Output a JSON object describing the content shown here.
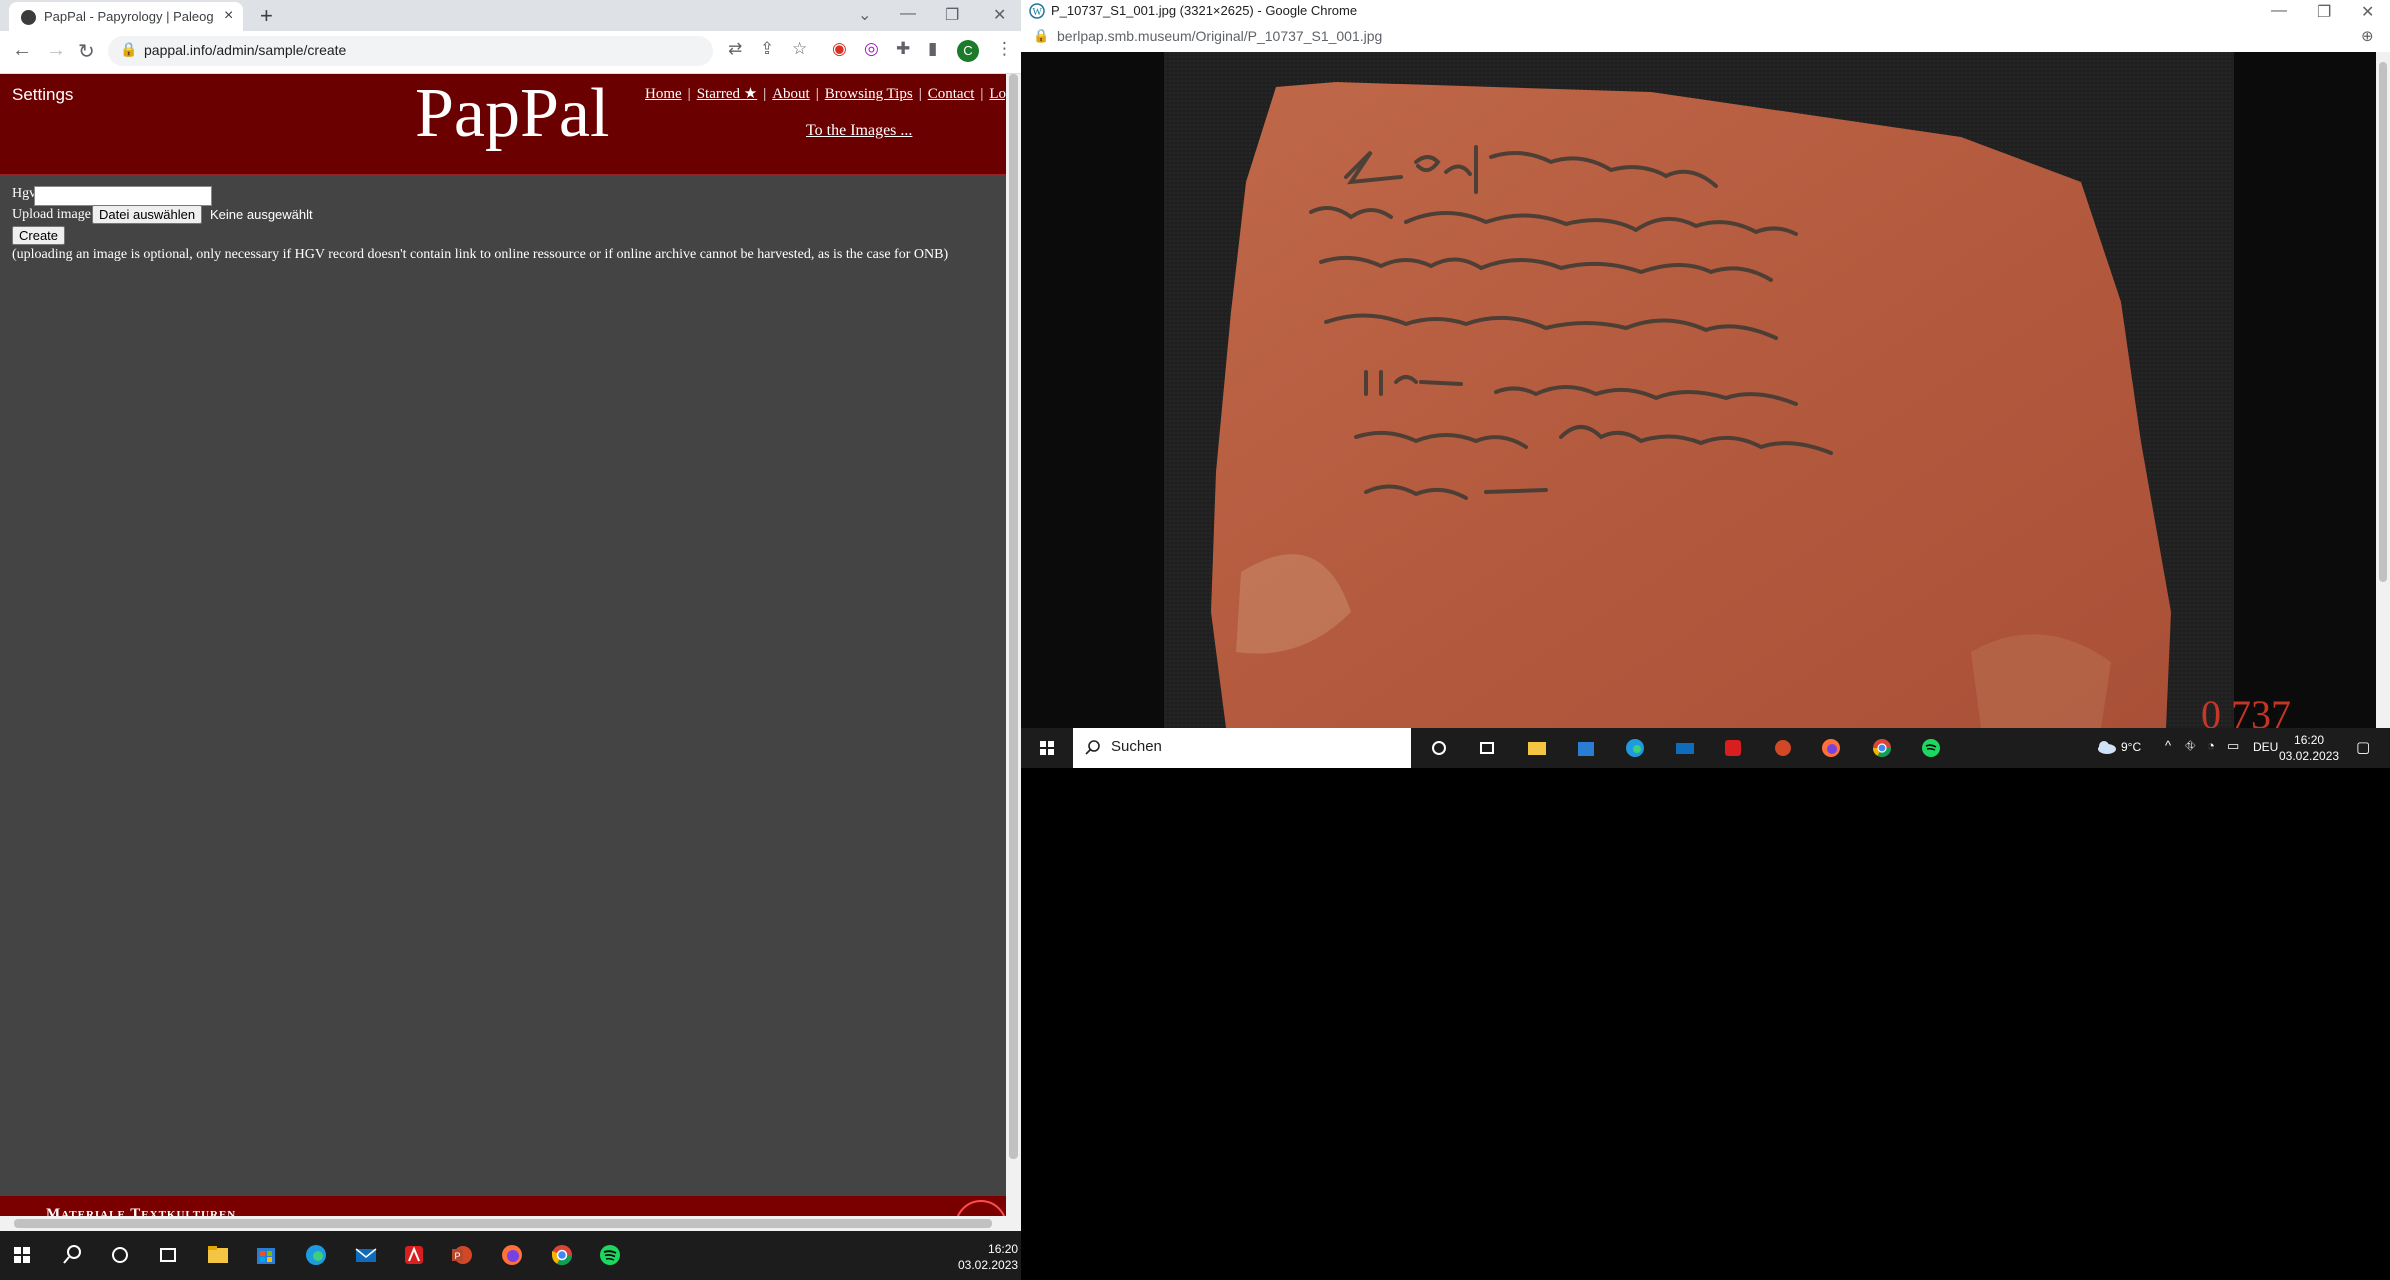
{
  "left_browser": {
    "tab_title": "PapPal - Papyrology | Paleograph",
    "new_tab_symbol": "+",
    "url": "pappal.info/admin/sample/create",
    "profile_initial": "C"
  },
  "site": {
    "settings_label": "Settings",
    "logo": "PapPal",
    "nav": [
      "Home",
      "Starred ★",
      "About",
      "Browsing Tips",
      "Contact",
      "Logout"
    ],
    "nav_separator": "|",
    "to_images": "To the Images ...",
    "footer_text": "Materiale Textkulturen"
  },
  "form": {
    "hgv_label": "Hgv",
    "hgv_value": "",
    "upload_label": "Upload image",
    "choose_file_button": "Datei auswählen",
    "no_file_text": "Keine ausgewählt",
    "create_button": "Create",
    "note": "(uploading an image is optional, only necessary if HGV record doesn't contain link to online ressource or if online archive cannot be harvested, as is the case for ONB)"
  },
  "right_browser": {
    "title": "P_10737_S1_001.jpg (3321×2625) - Google Chrome",
    "url_domain": "berlpap.smb.museum",
    "url_path": "/Original/P_10737_S1_001.jpg"
  },
  "taskbar_left": {
    "time": "16:20",
    "date": "03.02.2023",
    "apps": [
      "start-icon",
      "search-icon",
      "cortana-icon",
      "task-view-icon",
      "file-explorer-icon",
      "store-icon",
      "edge-icon",
      "mail-icon",
      "acrobat-icon",
      "powerpoint-icon",
      "firefox-icon",
      "chrome-icon",
      "spotify-icon"
    ]
  },
  "taskbar_right": {
    "search_placeholder": "Suchen",
    "weather": "9°C",
    "language": "DEU",
    "time": "16:20",
    "date": "03.02.2023"
  },
  "colors": {
    "header_red": "#6b0000",
    "page_grey": "#444444",
    "ostracon": "#b65f45"
  }
}
